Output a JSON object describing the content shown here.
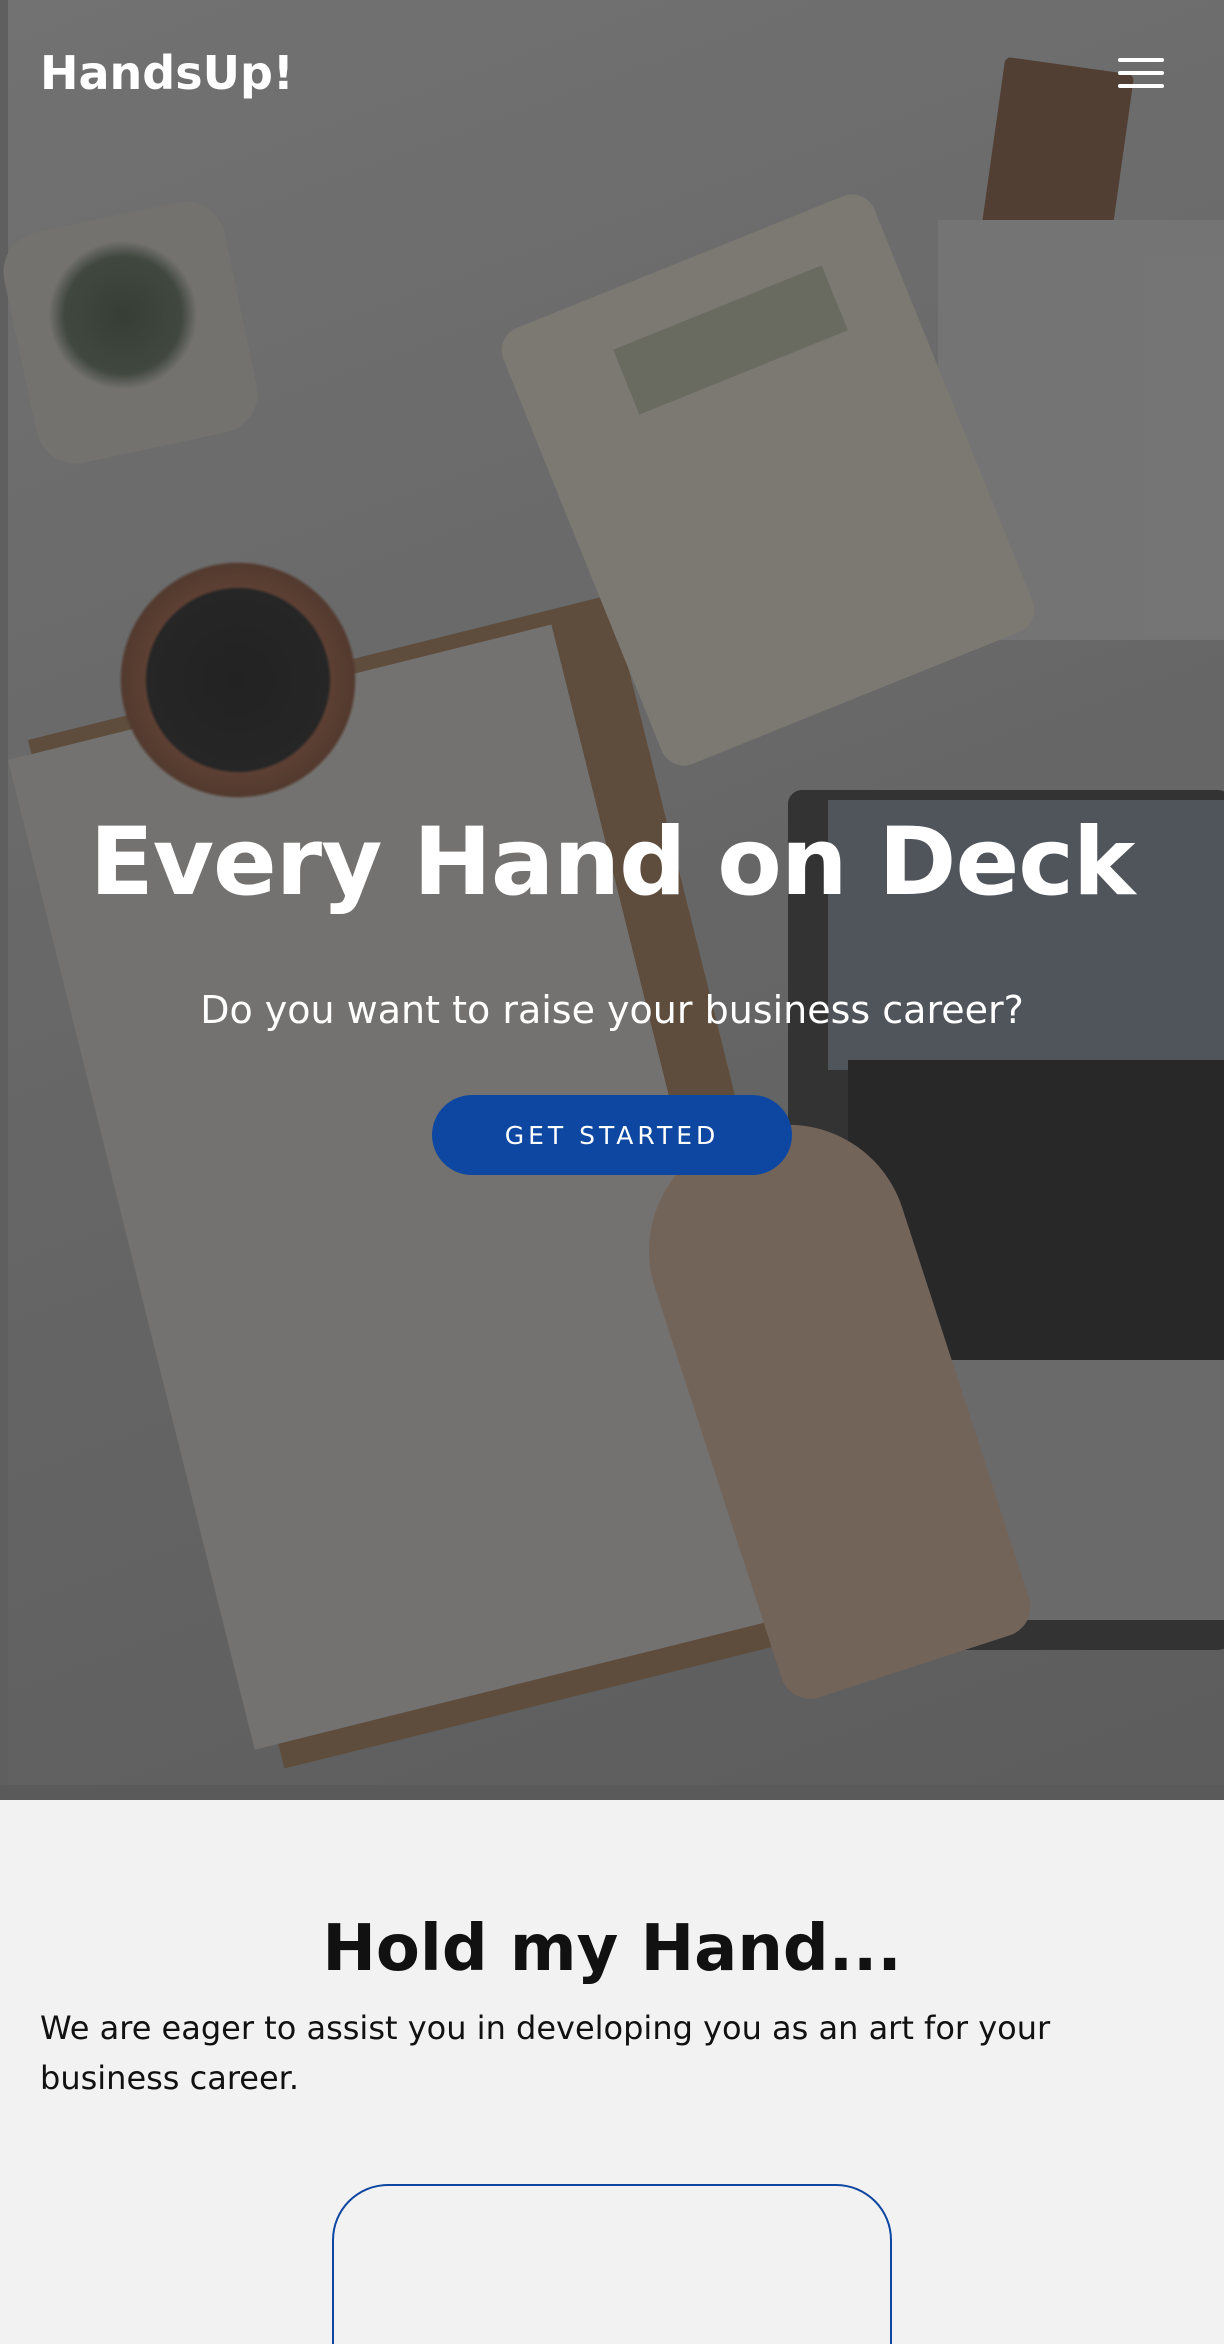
{
  "header": {
    "brand": "HandsUp!",
    "menu_icon": "hamburger-menu-icon"
  },
  "hero": {
    "title": "Every Hand on Deck",
    "subtitle": "Do you want to raise your business career?",
    "cta_label": "GET STARTED",
    "cta_color": "#0d47a1"
  },
  "about": {
    "title": "Hold my Hand...",
    "text": "We are eager to assist you in developing you as an art for your business career."
  },
  "colors": {
    "accent": "#0d47a1",
    "background": "#f2f2f2"
  }
}
